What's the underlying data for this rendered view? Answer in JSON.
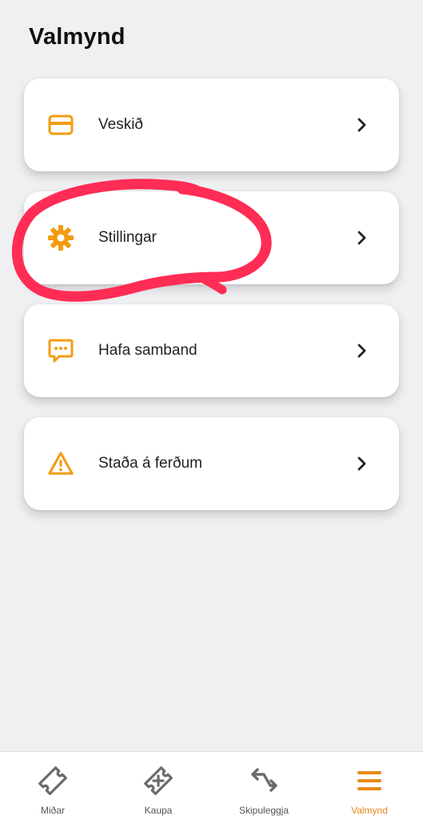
{
  "header": {
    "title": "Valmynd"
  },
  "menu": {
    "items": [
      {
        "label": "Veskið",
        "icon": "wallet-icon"
      },
      {
        "label": "Stillingar",
        "icon": "gear-icon"
      },
      {
        "label": "Hafa samband",
        "icon": "chat-bubble-icon"
      },
      {
        "label": "Staða á ferðum",
        "icon": "warning-triangle-icon"
      }
    ]
  },
  "tabbar": {
    "tabs": [
      {
        "label": "Miðar",
        "icon": "ticket-icon",
        "active": false
      },
      {
        "label": "Kaupa",
        "icon": "buy-ticket-icon",
        "active": false
      },
      {
        "label": "Skipuleggja",
        "icon": "route-arrows-icon",
        "active": false
      },
      {
        "label": "Valmynd",
        "icon": "hamburger-menu-icon",
        "active": true
      }
    ]
  },
  "colors": {
    "accent": "#f39c12",
    "active_tab": "#e8881c",
    "annotation": "#ff2d55",
    "background": "#eff0f2"
  }
}
